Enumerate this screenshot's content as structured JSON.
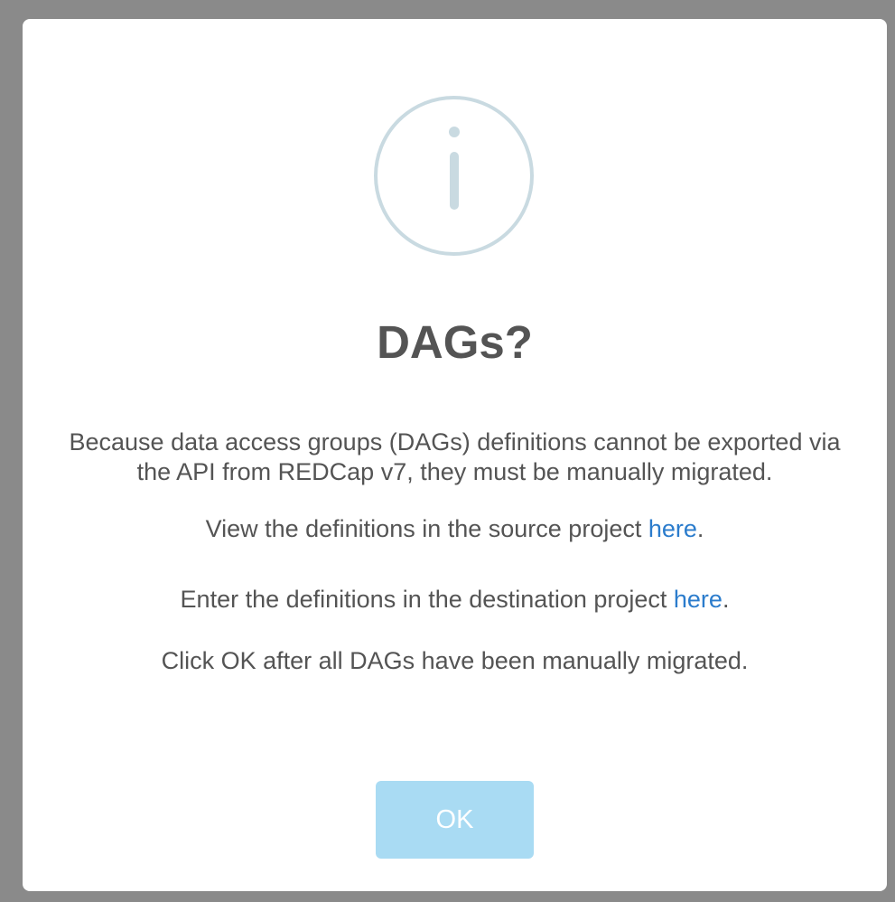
{
  "dialog": {
    "title": "DAGs?",
    "icon": "info-icon",
    "description": "Because data access groups (DAGs) definitions cannot be exported via the API from REDCap v7, they must be manually migrated.",
    "view_source": {
      "text_before": "View the definitions in the source project ",
      "link_label": "here",
      "text_after": "."
    },
    "enter_destination": {
      "text_before": "Enter the definitions in the destination project ",
      "link_label": "here",
      "text_after": "."
    },
    "instruction": "Click OK after all DAGs have been manually migrated.",
    "ok_label": "OK"
  },
  "colors": {
    "overlay": "#8a8a8a",
    "modal_background": "#ffffff",
    "icon": "#c9dae1",
    "text": "#545454",
    "link": "#2b7ccc",
    "ok_button_background": "#a9dbf3",
    "ok_button_text": "#ffffff"
  }
}
